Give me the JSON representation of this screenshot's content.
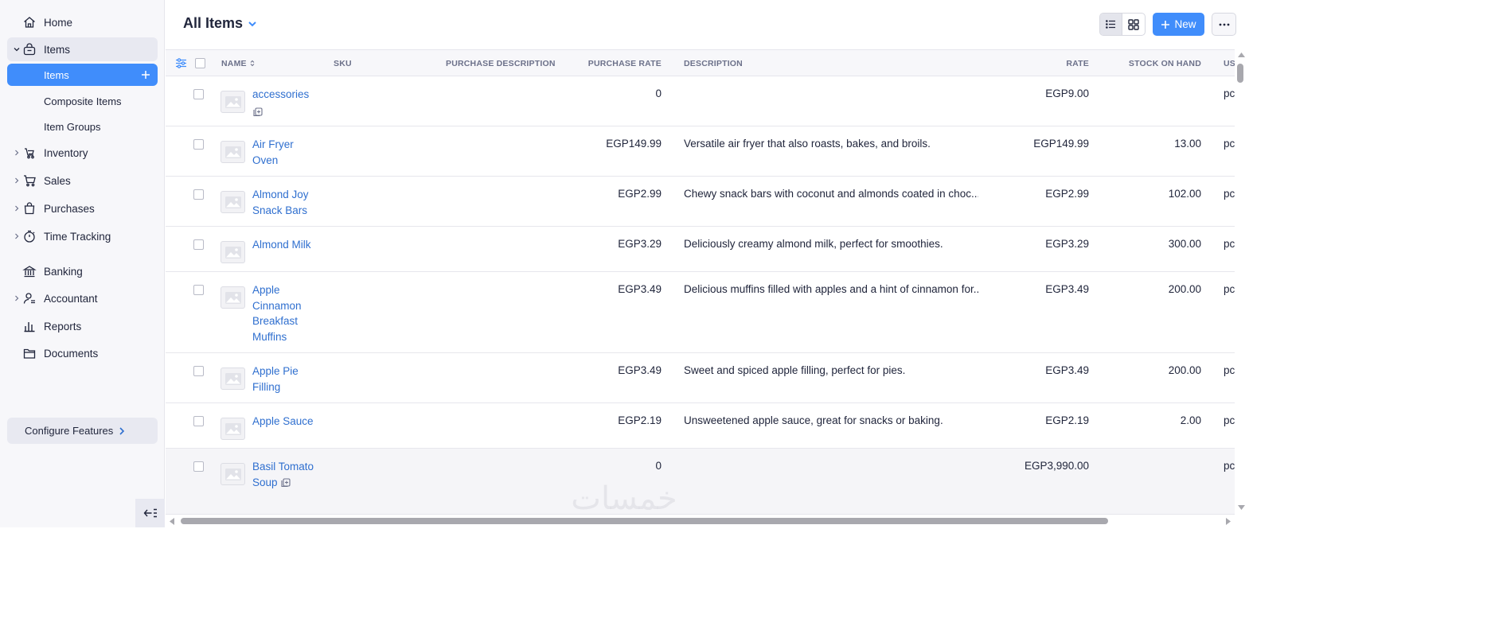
{
  "sidebar": {
    "home": "Home",
    "items_group": "Items",
    "sub_items": [
      {
        "label": "Items"
      },
      {
        "label": "Composite Items"
      },
      {
        "label": "Item Groups"
      }
    ],
    "inventory": "Inventory",
    "sales": "Sales",
    "purchases": "Purchases",
    "time_tracking": "Time Tracking",
    "banking": "Banking",
    "accountant": "Accountant",
    "reports": "Reports",
    "documents": "Documents",
    "configure": "Configure Features"
  },
  "header": {
    "title": "All Items",
    "new_label": "New"
  },
  "table": {
    "columns": {
      "name": "NAME",
      "sku": "SKU",
      "purchase_description": "PURCHASE DESCRIPTION",
      "purchase_rate": "PURCHASE RATE",
      "description": "DESCRIPTION",
      "rate": "RATE",
      "stock_on_hand": "STOCK ON HAND",
      "usage_unit": "US"
    },
    "rows": [
      {
        "name": "accessories",
        "composite": true,
        "purchase_rate": "0",
        "description": "",
        "rate": "EGP9.00",
        "stock": "",
        "unit": "pc"
      },
      {
        "name": "Air Fryer Oven",
        "composite": false,
        "purchase_rate": "EGP149.99",
        "description": "Versatile air fryer that also roasts, bakes, and broils.",
        "rate": "EGP149.99",
        "stock": "13.00",
        "unit": "pc"
      },
      {
        "name": "Almond Joy Snack Bars",
        "composite": false,
        "purchase_rate": "EGP2.99",
        "description": "Chewy snack bars with coconut and almonds coated in choc...",
        "rate": "EGP2.99",
        "stock": "102.00",
        "unit": "pc"
      },
      {
        "name": "Almond Milk",
        "composite": false,
        "purchase_rate": "EGP3.29",
        "description": "Deliciously creamy almond milk, perfect for smoothies.",
        "rate": "EGP3.29",
        "stock": "300.00",
        "unit": "pc"
      },
      {
        "name": "Apple Cinnamon Breakfast Muffins",
        "composite": false,
        "purchase_rate": "EGP3.49",
        "description": "Delicious muffins filled with apples and a hint of cinnamon for...",
        "rate": "EGP3.49",
        "stock": "200.00",
        "unit": "pc"
      },
      {
        "name": "Apple Pie Filling",
        "composite": false,
        "purchase_rate": "EGP3.49",
        "description": "Sweet and spiced apple filling, perfect for pies.",
        "rate": "EGP3.49",
        "stock": "200.00",
        "unit": "pc"
      },
      {
        "name": "Apple Sauce",
        "composite": false,
        "purchase_rate": "EGP2.19",
        "description": "Unsweetened apple sauce, great for snacks or baking.",
        "rate": "EGP2.19",
        "stock": "2.00",
        "unit": "pc"
      },
      {
        "name": "Basil Tomato Soup",
        "composite": true,
        "purchase_rate": "0",
        "description": "",
        "rate": "EGP3,990.00",
        "stock": "",
        "unit": "pc"
      }
    ]
  },
  "watermark": "خمسات",
  "colors": {
    "accent": "#408dfb",
    "link": "#2f6fcf",
    "sidebar_bg": "#f7f7fa"
  }
}
